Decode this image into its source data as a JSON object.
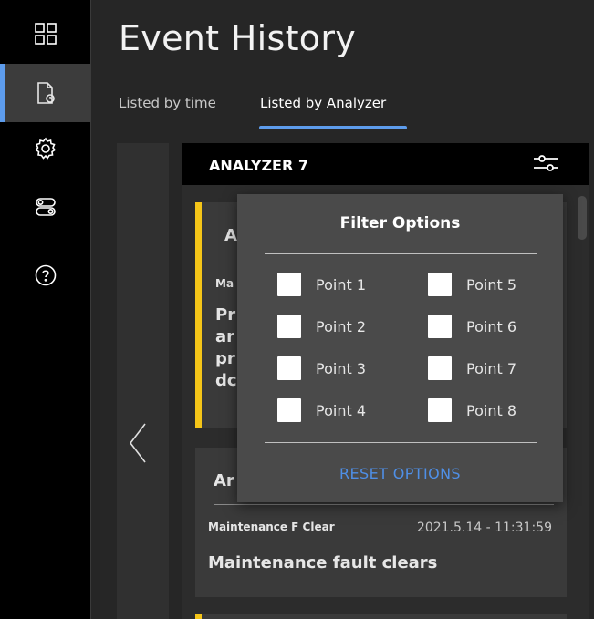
{
  "sidebar": {
    "items": [
      {
        "icon": "dashboard-grid-icon"
      },
      {
        "icon": "event-history-document-icon",
        "active": true
      },
      {
        "icon": "settings-gear-icon"
      },
      {
        "icon": "toggle-switches-icon"
      },
      {
        "icon": "help-question-icon"
      }
    ]
  },
  "header": {
    "title": "Event History",
    "tabs": [
      {
        "label": "Listed by time"
      },
      {
        "label": "Listed by Analyzer",
        "active": true
      }
    ]
  },
  "analyzer": {
    "title": "ANALYZER 7",
    "filter_icon": "filter-sliders-icon"
  },
  "events": [
    {
      "title_partial": "A",
      "code_partial": "Ma",
      "desc_partial": "Pr ar pr dc"
    },
    {
      "title_partial": "Ar",
      "code": "Maintenance F Clear",
      "timestamp": "2021.5.14 - 11:31:59",
      "description": "Maintenance fault clears"
    }
  ],
  "filter": {
    "title": "Filter Options",
    "options": [
      {
        "label": "Point 1",
        "checked": false
      },
      {
        "label": "Point 2",
        "checked": false
      },
      {
        "label": "Point 3",
        "checked": false
      },
      {
        "label": "Point 4",
        "checked": false
      },
      {
        "label": "Point 5",
        "checked": false
      },
      {
        "label": "Point 6",
        "checked": false
      },
      {
        "label": "Point 7",
        "checked": false
      },
      {
        "label": "Point 8",
        "checked": false
      }
    ],
    "reset_label": "RESET OPTIONS"
  },
  "colors": {
    "accent": "#5d9cec",
    "stripe": "#f5c518",
    "reset": "#4f8fe6"
  }
}
